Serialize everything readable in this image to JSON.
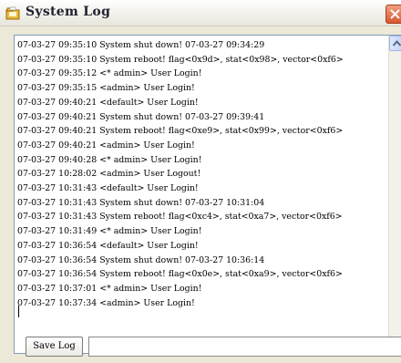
{
  "window": {
    "title": "System Log",
    "icons": {
      "app": "app-icon",
      "close": "close-icon"
    }
  },
  "log": {
    "lines": [
      "07-03-27 09:35:10 System shut down! 07-03-27 09:34:29",
      "07-03-27 09:35:10 System reboot! flag<0x9d>, stat<0x98>, vector<0xf6>",
      "07-03-27 09:35:12 <* admin> User Login!",
      "07-03-27 09:35:15 <admin> User Login!",
      "07-03-27 09:40:21 <default> User Login!",
      "07-03-27 09:40:21 System shut down! 07-03-27 09:39:41",
      "07-03-27 09:40:21 System reboot! flag<0xe9>, stat<0x99>, vector<0xf6>",
      "07-03-27 09:40:21 <admin> User Login!",
      "07-03-27 09:40:28 <* admin> User Login!",
      "07-03-27 10:28:02 <admin> User Logout!",
      "07-03-27 10:31:43 <default> User Login!",
      "07-03-27 10:31:43 System shut down! 07-03-27 10:31:04",
      "07-03-27 10:31:43 System reboot! flag<0xc4>, stat<0xa7>, vector<0xf6>",
      "07-03-27 10:31:49 <* admin> User Login!",
      "07-03-27 10:36:54 <default> User Login!",
      "07-03-27 10:36:54 System shut down! 07-03-27 10:36:14",
      "07-03-27 10:36:54 System reboot! flag<0x0e>, stat<0xa9>, vector<0xf6>",
      "07-03-27 10:37:01 <* admin> User Login!",
      "07-03-27 10:37:34 <admin> User Login!"
    ]
  },
  "footer": {
    "save_label": "Save Log",
    "status_text": ""
  },
  "scrollbar": {
    "up_icon": "arrow-up-icon",
    "down_icon": "arrow-down-icon"
  }
}
